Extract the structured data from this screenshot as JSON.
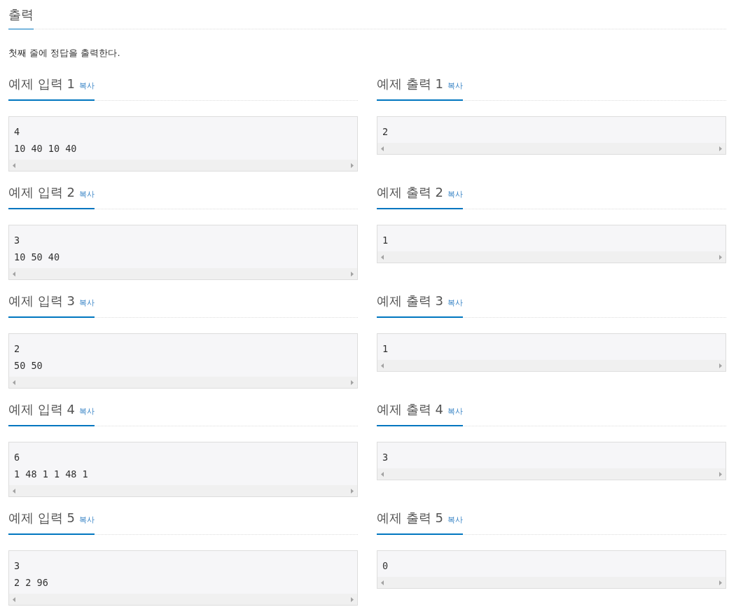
{
  "section": {
    "title": "출력",
    "description": "첫째 줄에 정답을 출력한다."
  },
  "samples": [
    {
      "input": {
        "title": "예제 입력 1",
        "copy": "복사",
        "lines": [
          "4",
          "10 40 10 40"
        ]
      },
      "output": {
        "title": "예제 출력 1",
        "copy": "복사",
        "lines": [
          "2"
        ]
      }
    },
    {
      "input": {
        "title": "예제 입력 2",
        "copy": "복사",
        "lines": [
          "3",
          "10 50 40"
        ]
      },
      "output": {
        "title": "예제 출력 2",
        "copy": "복사",
        "lines": [
          "1"
        ]
      }
    },
    {
      "input": {
        "title": "예제 입력 3",
        "copy": "복사",
        "lines": [
          "2",
          "50 50"
        ]
      },
      "output": {
        "title": "예제 출력 3",
        "copy": "복사",
        "lines": [
          "1"
        ]
      }
    },
    {
      "input": {
        "title": "예제 입력 4",
        "copy": "복사",
        "lines": [
          "6",
          "1 48 1 1 48 1"
        ]
      },
      "output": {
        "title": "예제 출력 4",
        "copy": "복사",
        "lines": [
          "3"
        ]
      }
    },
    {
      "input": {
        "title": "예제 입력 5",
        "copy": "복사",
        "lines": [
          "3",
          "2 2 96"
        ]
      },
      "output": {
        "title": "예제 출력 5",
        "copy": "복사",
        "lines": [
          "0"
        ]
      }
    }
  ]
}
